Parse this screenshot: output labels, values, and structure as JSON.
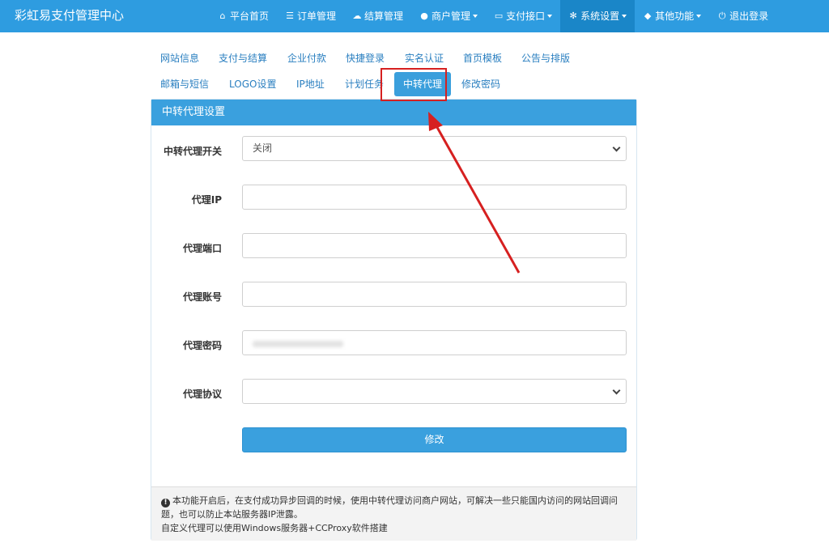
{
  "brand": "彩虹易支付管理中心",
  "nav": {
    "items": [
      {
        "label": "平台首页",
        "icon": "home-icon",
        "glyph": "⌂",
        "dropdown": false
      },
      {
        "label": "订单管理",
        "icon": "list-icon",
        "glyph": "☰",
        "dropdown": false
      },
      {
        "label": "结算管理",
        "icon": "cloud-icon",
        "glyph": "☁",
        "dropdown": false
      },
      {
        "label": "商户管理",
        "icon": "user-icon",
        "glyph": "●",
        "dropdown": true
      },
      {
        "label": "支付接口",
        "icon": "card-icon",
        "glyph": "▭",
        "dropdown": true
      },
      {
        "label": "系统设置",
        "icon": "gear-icon",
        "glyph": "✻",
        "dropdown": true,
        "active": true
      },
      {
        "label": "其他功能",
        "icon": "cube-icon",
        "glyph": "◆",
        "dropdown": true
      },
      {
        "label": "退出登录",
        "icon": "power-icon",
        "glyph": "⏻",
        "dropdown": false
      }
    ]
  },
  "tabs": {
    "row1": [
      "网站信息",
      "支付与结算",
      "企业付款",
      "快捷登录",
      "实名认证",
      "首页模板",
      "公告与排版"
    ],
    "row2": [
      "邮箱与短信",
      "LOGO设置",
      "IP地址",
      "计划任务",
      "中转代理",
      "修改密码"
    ],
    "active": "中转代理"
  },
  "panel": {
    "title": "中转代理设置",
    "fields": {
      "switch_label": "中转代理开关",
      "switch_value": "关闭",
      "ip_label": "代理IP",
      "ip_value": "",
      "port_label": "代理端口",
      "port_value": "",
      "account_label": "代理账号",
      "account_value": "",
      "password_label": "代理密码",
      "protocol_label": "代理协议",
      "protocol_value": ""
    },
    "submit_label": "修改",
    "footer": {
      "line1": "本功能开启后，在支付成功异步回调的时候，使用中转代理访问商户网站，可解决一些只能国内访问的网站回调问题，也可以防止本站服务器IP泄露。",
      "line2": "自定义代理可以使用Windows服务器+CCProxy软件搭建"
    }
  },
  "colors": {
    "navbar": "#2e9ce0",
    "nav_active": "#1a86c8",
    "accent": "#3aa0de",
    "annotation": "#d62020"
  }
}
